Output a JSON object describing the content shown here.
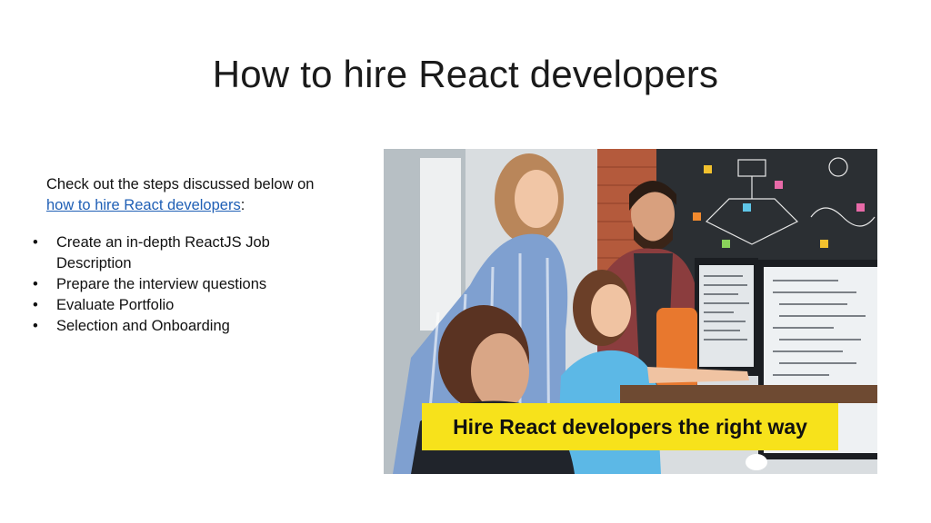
{
  "slide": {
    "title": "How to hire React developers",
    "intro_text": "Check out the steps discussed below on",
    "intro_link": "how to hire React developers",
    "intro_suffix": ":",
    "bullet_char": "•",
    "bullets": [
      "Create an in-depth ReactJS Job Description",
      "Prepare the interview questions",
      "Evaluate Portfolio",
      "Selection and Onboarding"
    ]
  },
  "image": {
    "banner_text": "Hire React developers the right way",
    "banner_color": "#f7e21b"
  },
  "colors": {
    "link": "#1f5fb5",
    "text": "#111111"
  }
}
